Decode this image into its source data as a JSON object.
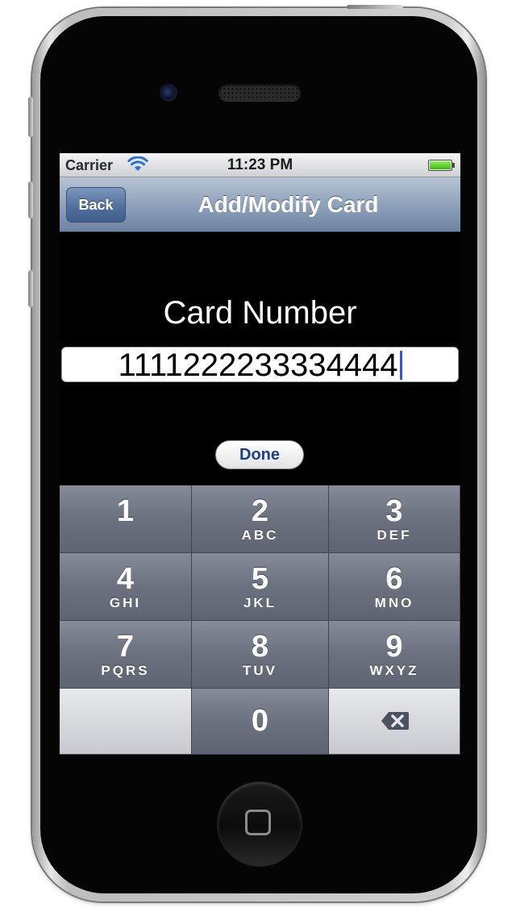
{
  "status_bar": {
    "carrier": "Carrier",
    "time": "11:23 PM",
    "icons": [
      "wifi-icon",
      "battery-icon"
    ]
  },
  "nav_bar": {
    "back_label": "Back",
    "title": "Add/Modify Card"
  },
  "form": {
    "card_number_label": "Card Number",
    "card_number_value": "1111222233334444"
  },
  "toolbar": {
    "done_label": "Done"
  },
  "keypad": {
    "keys": [
      {
        "num": "1",
        "letters": ""
      },
      {
        "num": "2",
        "letters": "ABC"
      },
      {
        "num": "3",
        "letters": "DEF"
      },
      {
        "num": "4",
        "letters": "GHI"
      },
      {
        "num": "5",
        "letters": "JKL"
      },
      {
        "num": "6",
        "letters": "MNO"
      },
      {
        "num": "7",
        "letters": "PQRS"
      },
      {
        "num": "8",
        "letters": "TUV"
      },
      {
        "num": "9",
        "letters": "WXYZ"
      },
      {
        "num": "0",
        "letters": ""
      }
    ],
    "delete_icon": "delete-backspace-icon"
  },
  "colors": {
    "nav_bar": "#8fa2bb",
    "back_button": "#55739f",
    "key": "#6b717f",
    "done_text": "#1f3f8a",
    "cursor": "#3355dd"
  }
}
